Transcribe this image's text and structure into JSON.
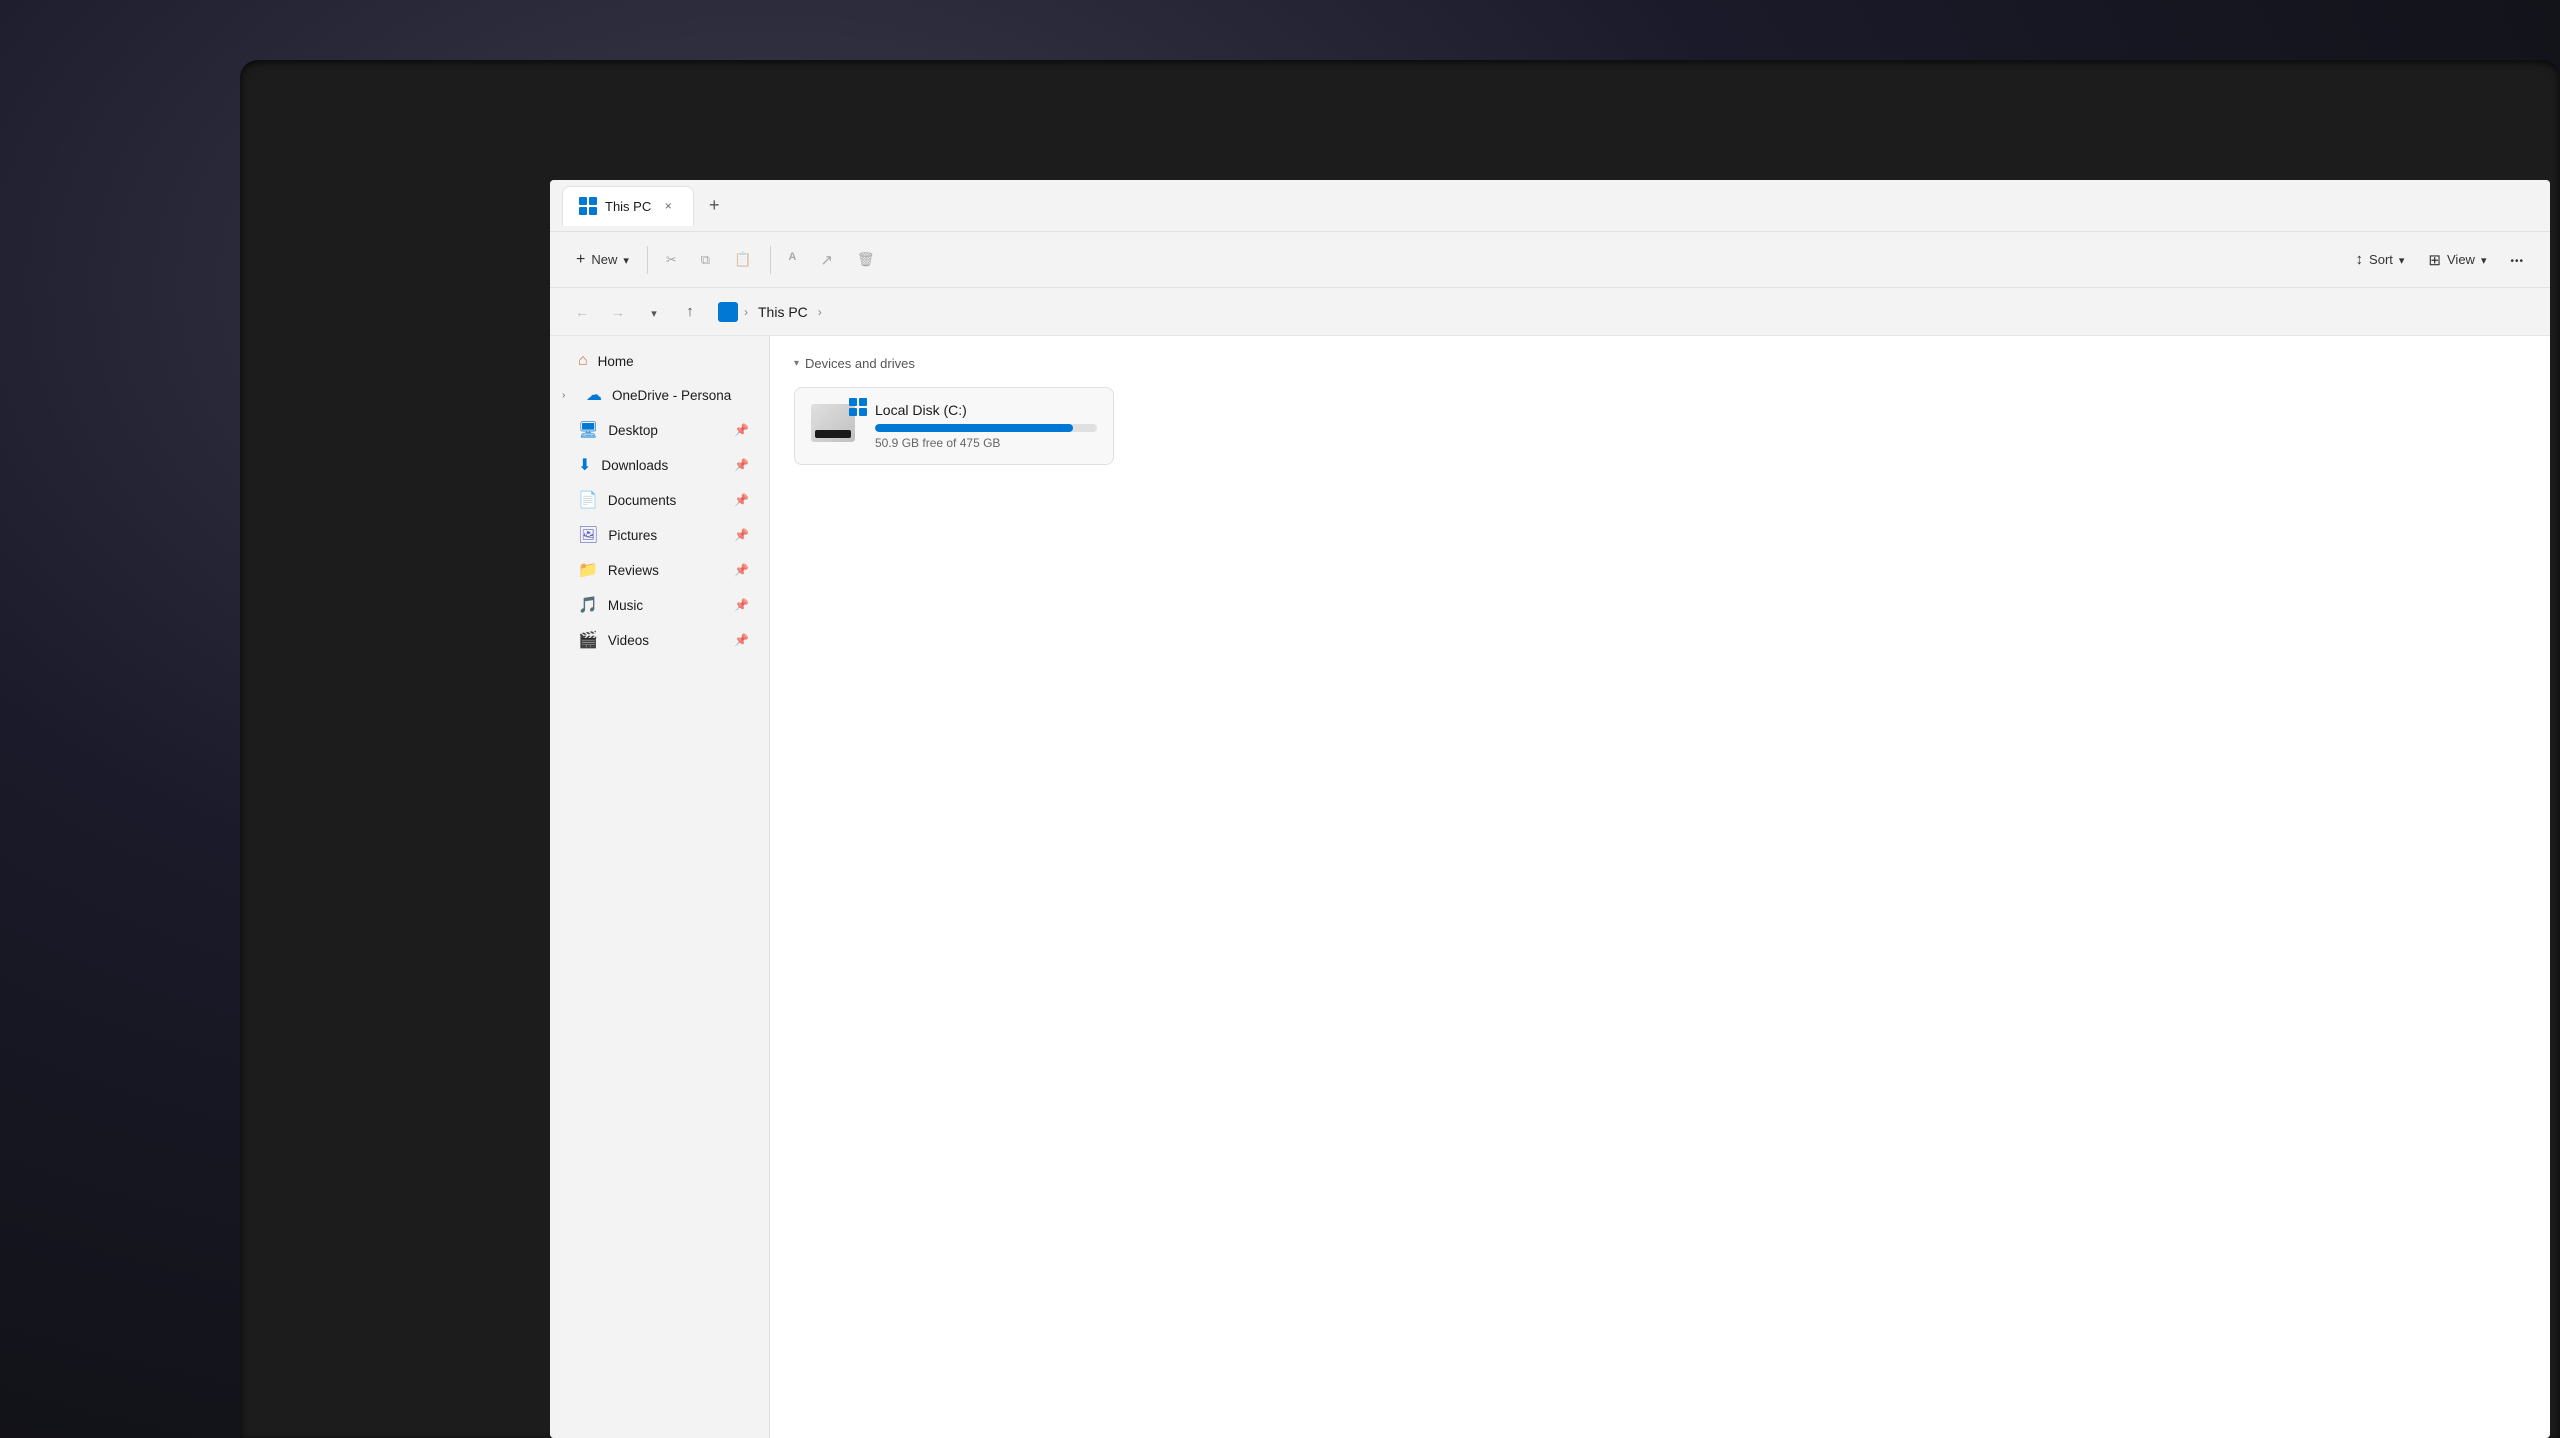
{
  "window": {
    "title": "This PC",
    "tab_close_label": "×",
    "tab_new_label": "+"
  },
  "toolbar": {
    "new_label": "New",
    "cut_label": "Cut",
    "copy_label": "Copy",
    "paste_label": "Paste",
    "rename_label": "Rename",
    "share_label": "Share",
    "delete_label": "Delete",
    "sort_label": "Sort",
    "view_label": "View",
    "more_label": "···"
  },
  "nav": {
    "breadcrumb_home": "This PC",
    "breadcrumb_separator": "›"
  },
  "sidebar": {
    "home_label": "Home",
    "onedrive_label": "OneDrive - Persona",
    "desktop_label": "Desktop",
    "downloads_label": "Downloads",
    "documents_label": "Documents",
    "pictures_label": "Pictures",
    "reviews_label": "Reviews",
    "music_label": "Music",
    "videos_label": "Videos"
  },
  "content": {
    "section_label": "Devices and drives",
    "drive_name": "Local Disk (C:)",
    "drive_free": "50.9 GB free of 475 GB",
    "drive_used_percent": 89
  }
}
